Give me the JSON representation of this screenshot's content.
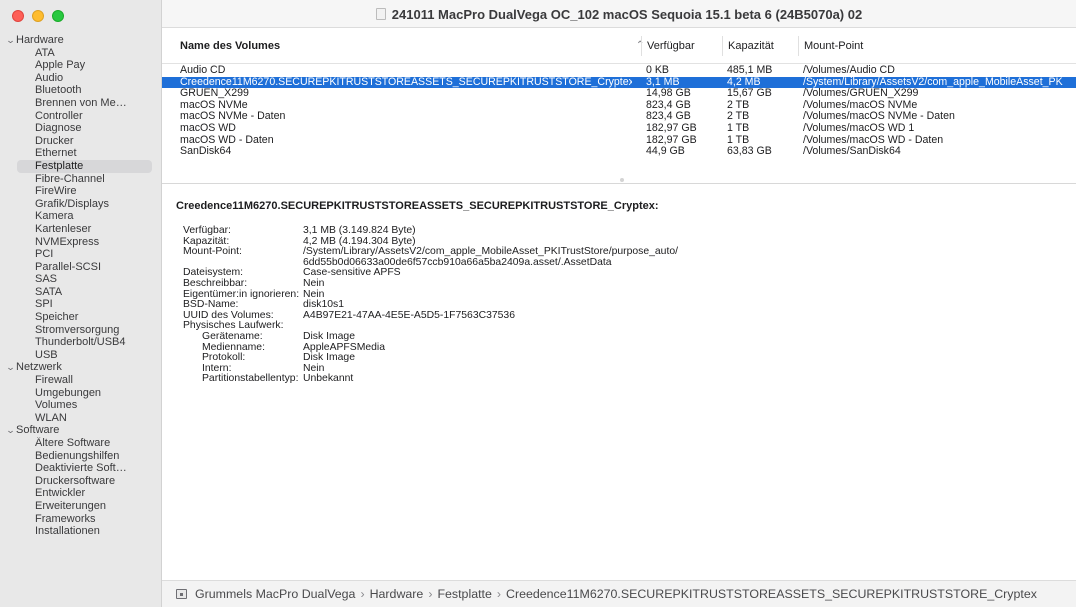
{
  "window": {
    "title": "241011 MacPro DualVega OC_102 macOS Sequoia 15.1 beta 6 (24B5070a) 02"
  },
  "sidebar": {
    "groups": [
      {
        "label": "Hardware",
        "items": [
          "ATA",
          "Apple Pay",
          "Audio",
          "Bluetooth",
          "Brennen von Me…",
          "Controller",
          "Diagnose",
          "Drucker",
          "Ethernet",
          "Festplatte",
          "Fibre-Channel",
          "FireWire",
          "Grafik/Displays",
          "Kamera",
          "Kartenleser",
          "NVMExpress",
          "PCI",
          "Parallel-SCSI",
          "SAS",
          "SATA",
          "SPI",
          "Speicher",
          "Stromversorgung",
          "Thunderbolt/USB4",
          "USB"
        ]
      },
      {
        "label": "Netzwerk",
        "items": [
          "Firewall",
          "Umgebungen",
          "Volumes",
          "WLAN"
        ]
      },
      {
        "label": "Software",
        "items": [
          "Ältere Software",
          "Bedienungshilfen",
          "Deaktivierte Soft…",
          "Druckersoftware",
          "Entwickler",
          "Erweiterungen",
          "Frameworks",
          "Installationen"
        ]
      }
    ],
    "selected": "Festplatte"
  },
  "table": {
    "columns": [
      "Name des Volumes",
      "Verfügbar",
      "Kapazität",
      "Mount-Point"
    ],
    "rows": [
      {
        "name": "Audio CD",
        "free": "0 KB",
        "cap": "485,1 MB",
        "mount": "/Volumes/Audio CD"
      },
      {
        "name": "Creedence11M6270.SECUREPKITRUSTSTOREASSETS_SECUREPKITRUSTSTORE_Cryptex",
        "free": "3,1 MB",
        "cap": "4,2 MB",
        "mount": "/System/Library/AssetsV2/com_apple_MobileAsset_PK"
      },
      {
        "name": "GRUEN_X299",
        "free": "14,98 GB",
        "cap": "15,67 GB",
        "mount": "/Volumes/GRUEN_X299"
      },
      {
        "name": "macOS NVMe",
        "free": "823,4 GB",
        "cap": "2 TB",
        "mount": "/Volumes/macOS NVMe"
      },
      {
        "name": "macOS NVMe - Daten",
        "free": "823,4 GB",
        "cap": "2 TB",
        "mount": "/Volumes/macOS NVMe - Daten"
      },
      {
        "name": "macOS WD",
        "free": "182,97 GB",
        "cap": "1 TB",
        "mount": "/Volumes/macOS WD 1"
      },
      {
        "name": "macOS WD - Daten",
        "free": "182,97 GB",
        "cap": "1 TB",
        "mount": "/Volumes/macOS WD - Daten"
      },
      {
        "name": "SanDisk64",
        "free": "44,9 GB",
        "cap": "63,83 GB",
        "mount": "/Volumes/SanDisk64"
      }
    ],
    "selected_index": 1
  },
  "detail": {
    "title": "Creedence11M6270.SECUREPKITRUSTSTOREASSETS_SECUREPKITRUSTSTORE_Cryptex:",
    "properties": [
      {
        "key": "Verfügbar:",
        "value": "3,1 MB (3.149.824 Byte)",
        "indent": false
      },
      {
        "key": "Kapazität:",
        "value": "4,2 MB (4.194.304 Byte)",
        "indent": false
      },
      {
        "key": "Mount-Point:",
        "value": "/System/Library/AssetsV2/com_apple_MobileAsset_PKITrustStore/purpose_auto/",
        "indent": false
      },
      {
        "key": "",
        "value": "6dd55b0d06633a00de6f57ccb910a66a5ba2409a.asset/.AssetData",
        "indent": false
      },
      {
        "key": "Dateisystem:",
        "value": "Case-sensitive APFS",
        "indent": false
      },
      {
        "key": "Beschreibbar:",
        "value": "Nein",
        "indent": false
      },
      {
        "key": "Eigentümer:in ignorieren:",
        "value": "Nein",
        "indent": false
      },
      {
        "key": "BSD-Name:",
        "value": "disk10s1",
        "indent": false
      },
      {
        "key": "UUID des Volumes:",
        "value": "A4B97E21-47AA-4E5E-A5D5-1F7563C37536",
        "indent": false
      },
      {
        "key": "Physisches Laufwerk:",
        "value": "",
        "indent": false
      },
      {
        "key": "Gerätename:",
        "value": "Disk Image",
        "indent": true
      },
      {
        "key": "Medienname:",
        "value": "AppleAPFSMedia",
        "indent": true
      },
      {
        "key": "Protokoll:",
        "value": "Disk Image",
        "indent": true
      },
      {
        "key": "Intern:",
        "value": "Nein",
        "indent": true
      },
      {
        "key": "Partitionstabellentyp:",
        "value": "Unbekannt",
        "indent": true
      }
    ]
  },
  "pathbar": {
    "items": [
      "Grummels MacPro DualVega",
      "Hardware",
      "Festplatte",
      "Creedence11M6270.SECUREPKITRUSTSTOREASSETS_SECUREPKITRUSTSTORE_Cryptex"
    ],
    "separator": "›"
  },
  "colors": {
    "selection": "#1e6fd8",
    "sidebar_bg": "#e8e8e8",
    "sidebar_selected": "#d7d7d9"
  }
}
